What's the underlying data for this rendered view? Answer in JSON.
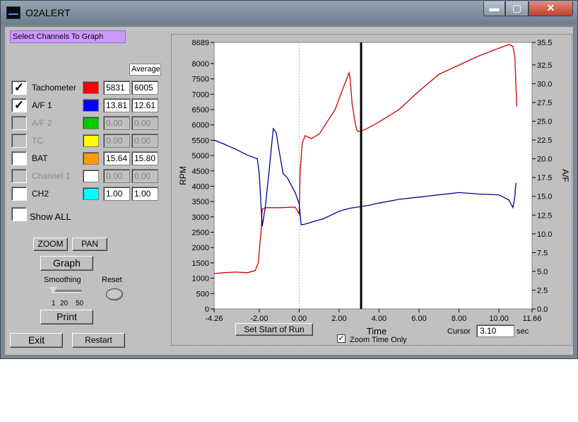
{
  "window": {
    "title": "O2ALERT",
    "minimize_glyph": "▬",
    "maximize_glyph": "▢",
    "close_glyph": "✕"
  },
  "panel": {
    "select_label": "Select Channels To Graph",
    "average_label": "Average",
    "channels": [
      {
        "name": "Tachometer",
        "checked": true,
        "enabled": true,
        "color": "#ff0000",
        "value": "5831",
        "average": "6005"
      },
      {
        "name": "A/F 1",
        "checked": true,
        "enabled": true,
        "color": "#0000ff",
        "value": "13.81",
        "average": "12.61"
      },
      {
        "name": "A/F 2",
        "checked": false,
        "enabled": false,
        "color": "#00cc00",
        "value": "0.00",
        "average": "0.00"
      },
      {
        "name": "TC",
        "checked": false,
        "enabled": false,
        "color": "#ffff00",
        "value": "0.00",
        "average": "0.00"
      },
      {
        "name": "BAT",
        "checked": false,
        "enabled": true,
        "color": "#ff9900",
        "value": "15.64",
        "average": "15.80"
      },
      {
        "name": "Channel 1",
        "checked": false,
        "enabled": false,
        "color": "#ffffff",
        "value": "0.00",
        "average": "0.00"
      },
      {
        "name": "CH2",
        "checked": false,
        "enabled": true,
        "color": "#00ffff",
        "value": "1.00",
        "average": "1.00"
      }
    ],
    "show_all_label": "Show ALL",
    "zoom_label": "ZOOM",
    "pan_label": "PAN",
    "graph_label": "Graph",
    "smoothing_label": "Smoothing",
    "smoothing_ticks": [
      "1",
      "20",
      "50"
    ],
    "smoothing_value": 1,
    "reset_label": "Reset",
    "print_label": "Print",
    "exit_label": "Exit",
    "restart_label": "Restart"
  },
  "footer": {
    "set_start_label": "Set Start of Run",
    "zoom_time_label": "Zoom Time Only",
    "zoom_time_checked": true,
    "cursor_label": "Cursor",
    "cursor_value": "3.10",
    "sec_label": "sec"
  },
  "chart_data": {
    "type": "line",
    "xlabel": "Time",
    "ylabel": "RPM",
    "y2label": "A/F",
    "xlim": [
      -4.26,
      11.66
    ],
    "ylim": [
      0,
      8689
    ],
    "y2lim": [
      0,
      35.5
    ],
    "xticks": [
      "-4.26",
      "-2.00",
      "0.00",
      "2.00",
      "4.00",
      "6.00",
      "8.00",
      "10.00",
      "11.66"
    ],
    "yticks": [
      "8689",
      "8000",
      "7500",
      "7000",
      "6500",
      "6000",
      "5500",
      "5000",
      "4500",
      "4000",
      "3500",
      "3000",
      "2500",
      "2000",
      "1500",
      "1000",
      "500",
      "0"
    ],
    "y2ticks": [
      "35.5",
      "32.5",
      "30.0",
      "27.5",
      "25.0",
      "22.5",
      "20.0",
      "17.5",
      "15.0",
      "12.5",
      "10.0",
      "7.5",
      "5.0",
      "2.5",
      "0.0"
    ],
    "cursor_x": 3.1,
    "grid": false,
    "series": [
      {
        "name": "Tachometer",
        "axis": "left",
        "color": "#cc0000",
        "x": [
          -4.26,
          -3.8,
          -3.2,
          -2.6,
          -2.2,
          -2.05,
          -1.9,
          -1.85,
          -1.7,
          -1.0,
          -0.2,
          0.0,
          0.05,
          0.15,
          0.3,
          0.6,
          1.0,
          1.4,
          1.8,
          2.2,
          2.5,
          2.55,
          2.65,
          2.8,
          2.9,
          3.0,
          3.3,
          3.6,
          4.0,
          5.0,
          6.0,
          7.0,
          8.0,
          9.0,
          10.0,
          10.5,
          10.7,
          10.8,
          10.85,
          10.9
        ],
        "values": [
          1150,
          1180,
          1200,
          1180,
          1250,
          1500,
          2600,
          3250,
          3300,
          3300,
          3320,
          3100,
          4500,
          5400,
          5650,
          5550,
          5700,
          6100,
          6500,
          7200,
          7700,
          7500,
          6700,
          6050,
          5800,
          5790,
          5850,
          5950,
          6100,
          6500,
          7100,
          7650,
          7950,
          8250,
          8500,
          8620,
          8560,
          8200,
          7300,
          6600
        ]
      },
      {
        "name": "A/F 1",
        "axis": "right",
        "color": "#000099",
        "x": [
          -4.26,
          -3.8,
          -3.2,
          -2.6,
          -2.1,
          -2.0,
          -1.85,
          -1.7,
          -1.5,
          -1.3,
          -1.15,
          -1.0,
          -0.8,
          -0.6,
          -0.4,
          -0.2,
          0.0,
          0.1,
          0.3,
          0.8,
          1.2,
          1.6,
          2.0,
          2.5,
          3.0,
          3.5,
          4.0,
          5.0,
          6.0,
          7.0,
          8.0,
          9.0,
          10.0,
          10.5,
          10.7,
          10.8,
          10.85
        ],
        "values": [
          22.5,
          22.0,
          21.3,
          20.5,
          20.0,
          18.0,
          11.0,
          13.5,
          18.5,
          24.0,
          23.5,
          21.0,
          18.0,
          17.5,
          16.5,
          15.5,
          14.0,
          11.2,
          11.3,
          11.7,
          12.0,
          12.5,
          13.0,
          13.4,
          13.6,
          13.8,
          14.1,
          14.6,
          14.9,
          15.2,
          15.5,
          15.3,
          15.2,
          14.5,
          13.5,
          15.0,
          16.8
        ]
      }
    ]
  }
}
